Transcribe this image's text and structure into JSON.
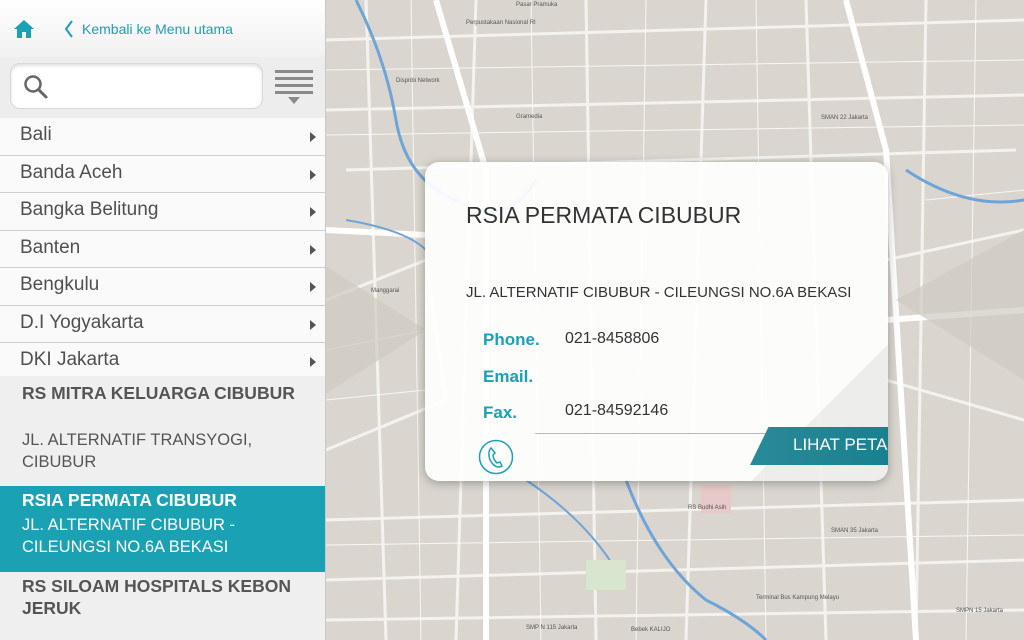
{
  "nav": {
    "home_icon": "home-icon",
    "back_label": "Kembali ke Menu utama"
  },
  "search": {
    "value": "",
    "placeholder": ""
  },
  "regions": [
    {
      "label": "Bali"
    },
    {
      "label": "Banda Aceh"
    },
    {
      "label": "Bangka Belitung"
    },
    {
      "label": "Banten"
    },
    {
      "label": "Bengkulu"
    },
    {
      "label": "D.I Yogyakarta"
    },
    {
      "label": "DKI Jakarta"
    }
  ],
  "hospitals": [
    {
      "name": "RS MITRA KELUARGA CIBUBUR",
      "address": "JL. ALTERNATIF TRANSYOGI, CIBUBUR"
    },
    {
      "name": "RSIA PERMATA CIBUBUR",
      "address": "JL. ALTERNATIF CIBUBUR - CILEUNGSI NO.6A BEKASI",
      "selected": true
    },
    {
      "name": "RS SILOAM HOSPITALS KEBON JERUK",
      "address": ""
    }
  ],
  "card": {
    "title": "RSIA PERMATA CIBUBUR",
    "address": "JL. ALTERNATIF CIBUBUR - CILEUNGSI NO.6A BEKASI",
    "phone_label": "Phone.",
    "phone": "021-8458806",
    "email_label": "Email.",
    "email": "",
    "fax_label": "Fax.",
    "fax": "021-84592146",
    "map_button": "LIHAT PETA"
  },
  "map_labels": {
    "a": "Pasar Pramuka",
    "b": "Perpustakaan Nasional RI",
    "c": "Dispnbi Network",
    "d": "Gramedia",
    "e": "SMAN 22 Jakarta",
    "f": "Manggarai",
    "g": "SMAN 35 Jakarta",
    "h": "RS Budhi Asih",
    "i": "SMP N 115 Jakarta",
    "j": "Bebek KALIJO",
    "k": "SMPN 15 Jakarta",
    "l": "Terminal Bus Kampung Melayu"
  },
  "colors": {
    "accent": "#1aa1b4",
    "accent_dark": "#137d8d",
    "map_bg": "#dad6cf",
    "river": "#6fa4d8"
  }
}
